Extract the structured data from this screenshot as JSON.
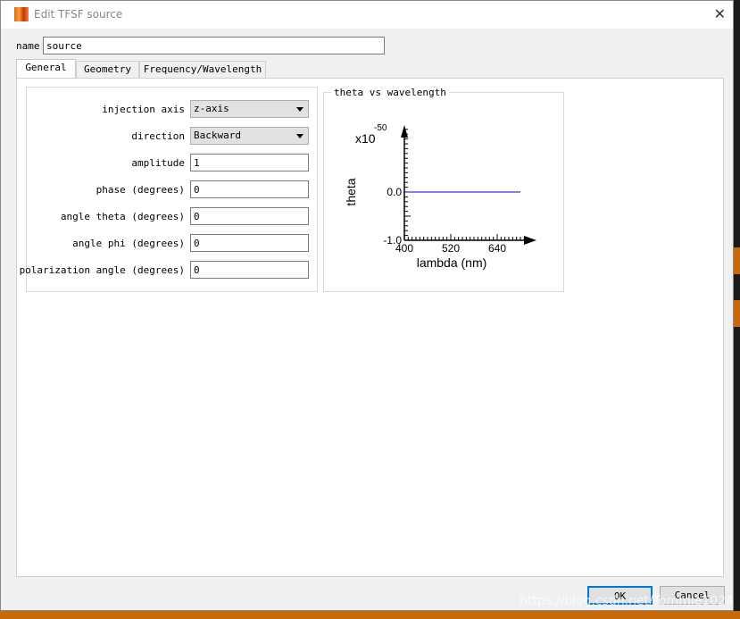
{
  "window": {
    "title": "Edit TFSF source",
    "close_icon": "close-icon"
  },
  "name_field": {
    "label": "name",
    "value": "source"
  },
  "tabs": [
    {
      "label": "General",
      "active": true
    },
    {
      "label": "Geometry"
    },
    {
      "label": "Frequency/Wavelength"
    }
  ],
  "fields": [
    {
      "label": "injection axis",
      "value": "z-axis",
      "type": "select"
    },
    {
      "label": "direction",
      "value": "Backward",
      "type": "select"
    },
    {
      "label": "amplitude",
      "value": "1"
    },
    {
      "label": "phase (degrees)",
      "value": "0"
    },
    {
      "label": "angle theta (degrees)",
      "value": "0"
    },
    {
      "label": "angle phi (degrees)",
      "value": "0"
    },
    {
      "label": "polarization angle (degrees)",
      "value": "0"
    }
  ],
  "chart_data": {
    "type": "line",
    "title": "theta vs wavelength",
    "xlabel": "lambda (nm)",
    "ylabel": "theta",
    "y_multiplier": "x10",
    "y_exponent": "-50",
    "xticks": [
      "400",
      "520",
      "640"
    ],
    "yticks": [
      "0.0",
      "-1.0"
    ],
    "xlim": [
      400,
      740
    ],
    "ylim": [
      -1.0,
      1.4
    ],
    "series": [
      {
        "x": [
          400,
          700
        ],
        "y": [
          0,
          0
        ],
        "color": "#0000cc"
      }
    ]
  },
  "buttons": {
    "ok": "OK",
    "cancel": "Cancel"
  },
  "watermark": "https://blog.csdn.net/Tommie1024"
}
